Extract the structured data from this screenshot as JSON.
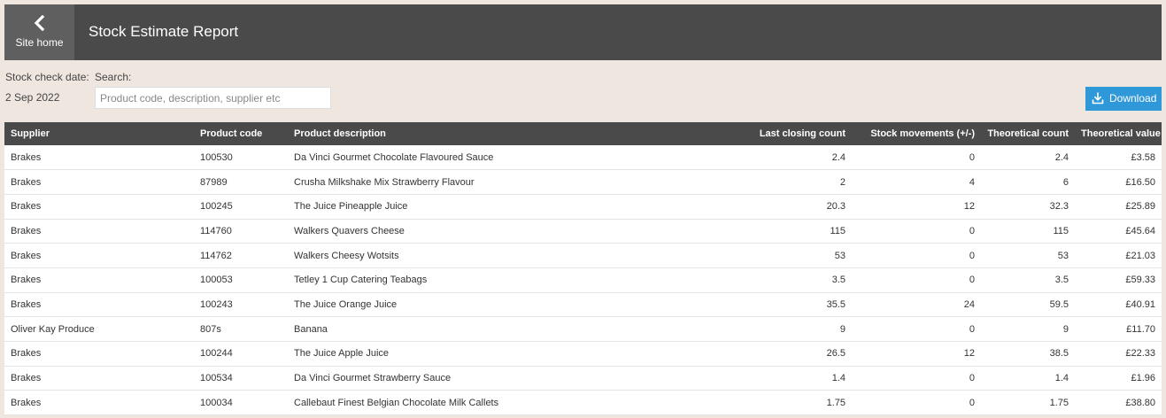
{
  "header": {
    "home_label": "Site home",
    "title": "Stock Estimate Report"
  },
  "filters": {
    "date_label": "Stock check date:",
    "date_value": "2 Sep 2022",
    "search_label": "Search:",
    "search_placeholder": "Product code, description, supplier etc",
    "search_value": ""
  },
  "download": {
    "label": "Download"
  },
  "colors": {
    "header_bg": "#4a4a4a",
    "accent": "#2f98d8",
    "page_bg": "#efe6e0"
  },
  "table": {
    "columns": [
      "Supplier",
      "Product code",
      "Product description",
      "Last closing count",
      "Stock movements (+/-)",
      "Theoretical count",
      "Theoretical value"
    ],
    "rows": [
      [
        "Brakes",
        "100530",
        "Da Vinci Gourmet Chocolate Flavoured Sauce",
        "2.4",
        "0",
        "2.4",
        "£3.58"
      ],
      [
        "Brakes",
        "87989",
        "Crusha Milkshake Mix Strawberry Flavour",
        "2",
        "4",
        "6",
        "£16.50"
      ],
      [
        "Brakes",
        "100245",
        "The Juice Pineapple Juice",
        "20.3",
        "12",
        "32.3",
        "£25.89"
      ],
      [
        "Brakes",
        "114760",
        "Walkers Quavers Cheese",
        "115",
        "0",
        "115",
        "£45.64"
      ],
      [
        "Brakes",
        "114762",
        "Walkers Cheesy Wotsits",
        "53",
        "0",
        "53",
        "£21.03"
      ],
      [
        "Brakes",
        "100053",
        "Tetley 1 Cup Catering Teabags",
        "3.5",
        "0",
        "3.5",
        "£59.33"
      ],
      [
        "Brakes",
        "100243",
        "The Juice Orange Juice",
        "35.5",
        "24",
        "59.5",
        "£40.91"
      ],
      [
        "Oliver Kay Produce",
        "807s",
        "Banana",
        "9",
        "0",
        "9",
        "£11.70"
      ],
      [
        "Brakes",
        "100244",
        "The Juice Apple Juice",
        "26.5",
        "12",
        "38.5",
        "£22.33"
      ],
      [
        "Brakes",
        "100534",
        "Da Vinci Gourmet Strawberry Sauce",
        "1.4",
        "0",
        "1.4",
        "£1.96"
      ],
      [
        "Brakes",
        "100034",
        "Callebaut Finest Belgian Chocolate Milk Callets",
        "1.75",
        "0",
        "1.75",
        "£38.80"
      ]
    ]
  }
}
